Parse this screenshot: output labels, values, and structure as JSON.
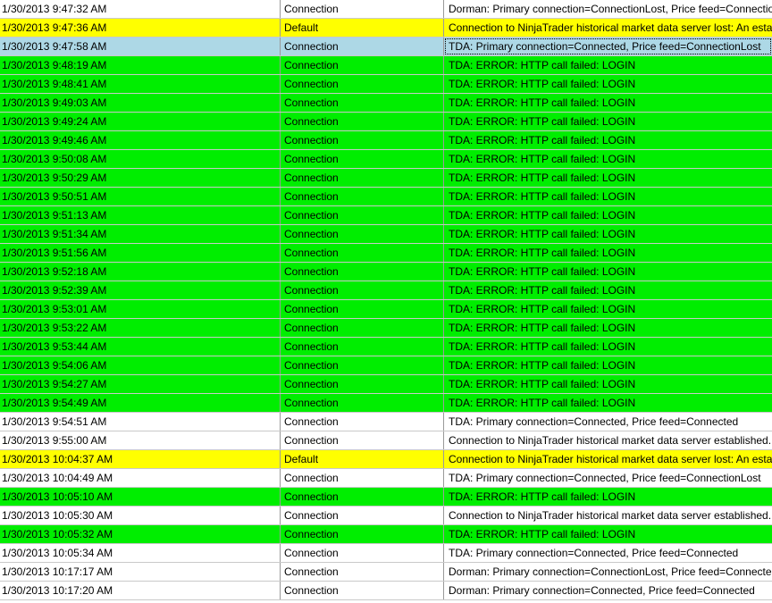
{
  "colors": {
    "white": "#ffffff",
    "yellow": "#ffff00",
    "green": "#00ee00",
    "selected": "#add8e6",
    "gridline": "#c9c9c9"
  },
  "log": {
    "rows": [
      {
        "time": "1/30/2013 9:47:32 AM",
        "category": "Connection",
        "message": "Dorman: Primary connection=ConnectionLost, Price feed=ConnectionLost",
        "color": "white"
      },
      {
        "time": "1/30/2013 9:47:36 AM",
        "category": "Default",
        "message": "Connection to NinjaTrader historical market data server lost: An established connection was aborted",
        "color": "yellow"
      },
      {
        "time": "1/30/2013 9:47:58 AM",
        "category": "Connection",
        "message": "TDA: Primary connection=Connected, Price feed=ConnectionLost",
        "color": "selected",
        "selected": true
      },
      {
        "time": "1/30/2013 9:48:19 AM",
        "category": "Connection",
        "message": "TDA: ERROR: HTTP call failed: LOGIN",
        "color": "green"
      },
      {
        "time": "1/30/2013 9:48:41 AM",
        "category": "Connection",
        "message": "TDA: ERROR: HTTP call failed: LOGIN",
        "color": "green"
      },
      {
        "time": "1/30/2013 9:49:03 AM",
        "category": "Connection",
        "message": "TDA: ERROR: HTTP call failed: LOGIN",
        "color": "green"
      },
      {
        "time": "1/30/2013 9:49:24 AM",
        "category": "Connection",
        "message": "TDA: ERROR: HTTP call failed: LOGIN",
        "color": "green"
      },
      {
        "time": "1/30/2013 9:49:46 AM",
        "category": "Connection",
        "message": "TDA: ERROR: HTTP call failed: LOGIN",
        "color": "green"
      },
      {
        "time": "1/30/2013 9:50:08 AM",
        "category": "Connection",
        "message": "TDA: ERROR: HTTP call failed: LOGIN",
        "color": "green"
      },
      {
        "time": "1/30/2013 9:50:29 AM",
        "category": "Connection",
        "message": "TDA: ERROR: HTTP call failed: LOGIN",
        "color": "green"
      },
      {
        "time": "1/30/2013 9:50:51 AM",
        "category": "Connection",
        "message": "TDA: ERROR: HTTP call failed: LOGIN",
        "color": "green"
      },
      {
        "time": "1/30/2013 9:51:13 AM",
        "category": "Connection",
        "message": "TDA: ERROR: HTTP call failed: LOGIN",
        "color": "green"
      },
      {
        "time": "1/30/2013 9:51:34 AM",
        "category": "Connection",
        "message": "TDA: ERROR: HTTP call failed: LOGIN",
        "color": "green"
      },
      {
        "time": "1/30/2013 9:51:56 AM",
        "category": "Connection",
        "message": "TDA: ERROR: HTTP call failed: LOGIN",
        "color": "green"
      },
      {
        "time": "1/30/2013 9:52:18 AM",
        "category": "Connection",
        "message": "TDA: ERROR: HTTP call failed: LOGIN",
        "color": "green"
      },
      {
        "time": "1/30/2013 9:52:39 AM",
        "category": "Connection",
        "message": "TDA: ERROR: HTTP call failed: LOGIN",
        "color": "green"
      },
      {
        "time": "1/30/2013 9:53:01 AM",
        "category": "Connection",
        "message": "TDA: ERROR: HTTP call failed: LOGIN",
        "color": "green"
      },
      {
        "time": "1/30/2013 9:53:22 AM",
        "category": "Connection",
        "message": "TDA: ERROR: HTTP call failed: LOGIN",
        "color": "green"
      },
      {
        "time": "1/30/2013 9:53:44 AM",
        "category": "Connection",
        "message": "TDA: ERROR: HTTP call failed: LOGIN",
        "color": "green"
      },
      {
        "time": "1/30/2013 9:54:06 AM",
        "category": "Connection",
        "message": "TDA: ERROR: HTTP call failed: LOGIN",
        "color": "green"
      },
      {
        "time": "1/30/2013 9:54:27 AM",
        "category": "Connection",
        "message": "TDA: ERROR: HTTP call failed: LOGIN",
        "color": "green"
      },
      {
        "time": "1/30/2013 9:54:49 AM",
        "category": "Connection",
        "message": "TDA: ERROR: HTTP call failed: LOGIN",
        "color": "green"
      },
      {
        "time": "1/30/2013 9:54:51 AM",
        "category": "Connection",
        "message": "TDA: Primary connection=Connected, Price feed=Connected",
        "color": "white"
      },
      {
        "time": "1/30/2013 9:55:00 AM",
        "category": "Connection",
        "message": "Connection to NinjaTrader historical market data server established.",
        "color": "white"
      },
      {
        "time": "1/30/2013 10:04:37 AM",
        "category": "Default",
        "message": "Connection to NinjaTrader historical market data server lost: An established connection was aborted",
        "color": "yellow"
      },
      {
        "time": "1/30/2013 10:04:49 AM",
        "category": "Connection",
        "message": "TDA: Primary connection=Connected, Price feed=ConnectionLost",
        "color": "white"
      },
      {
        "time": "1/30/2013 10:05:10 AM",
        "category": "Connection",
        "message": "TDA: ERROR: HTTP call failed: LOGIN",
        "color": "green"
      },
      {
        "time": "1/30/2013 10:05:30 AM",
        "category": "Connection",
        "message": "Connection to NinjaTrader historical market data server established.",
        "color": "white"
      },
      {
        "time": "1/30/2013 10:05:32 AM",
        "category": "Connection",
        "message": "TDA: ERROR: HTTP call failed: LOGIN",
        "color": "green"
      },
      {
        "time": "1/30/2013 10:05:34 AM",
        "category": "Connection",
        "message": "TDA: Primary connection=Connected, Price feed=Connected",
        "color": "white"
      },
      {
        "time": "1/30/2013 10:17:17 AM",
        "category": "Connection",
        "message": "Dorman: Primary connection=ConnectionLost, Price feed=Connected",
        "color": "white"
      },
      {
        "time": "1/30/2013 10:17:20 AM",
        "category": "Connection",
        "message": "Dorman: Primary connection=Connected, Price feed=Connected",
        "color": "white"
      }
    ]
  }
}
